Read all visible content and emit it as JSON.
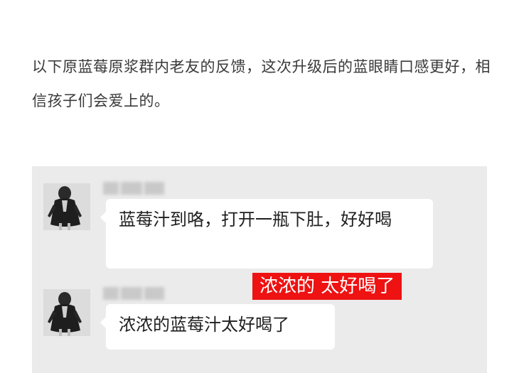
{
  "intro": {
    "text": "以下原蓝莓原浆群内老友的反馈，这次升级后的蓝眼睛口感更好，相信孩子们会爱上的。"
  },
  "chat": {
    "messages": [
      {
        "avatar": "user-avatar",
        "text": "蓝莓汁到咯，打开一瓶下肚，好好喝"
      },
      {
        "avatar": "user-avatar",
        "text": "浓浓的蓝莓汁太好喝了"
      }
    ],
    "caption": "浓浓的 太好喝了"
  }
}
